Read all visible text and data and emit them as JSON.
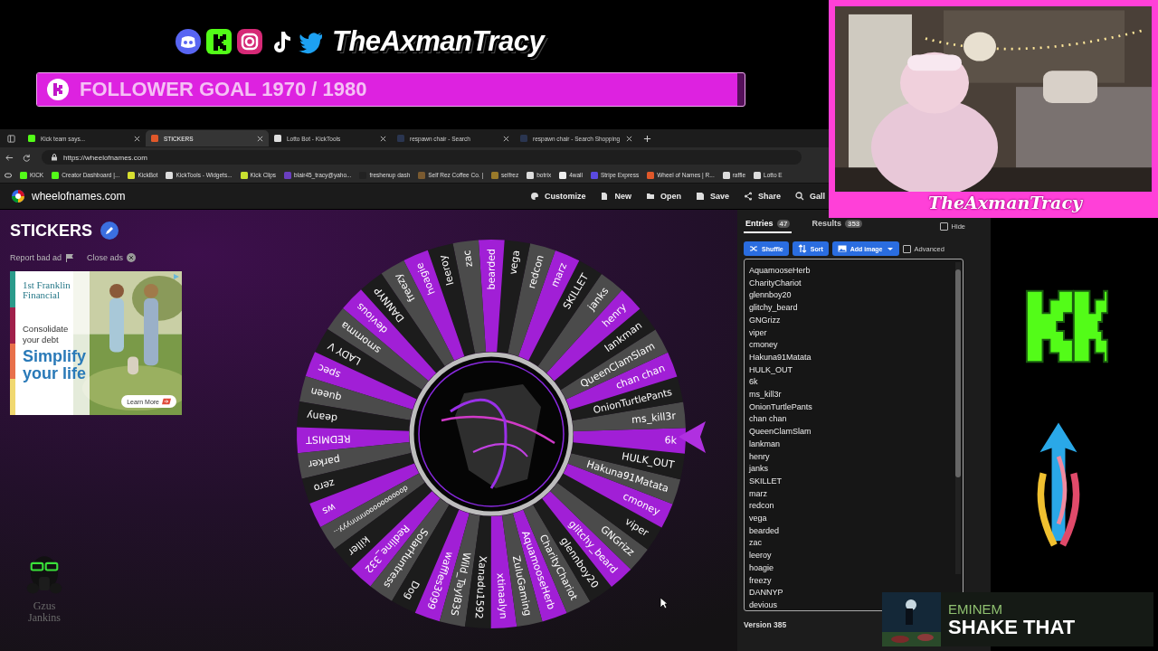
{
  "overlay": {
    "channel_name": "TheAxmanTracy",
    "goal": {
      "label": "FOLLOWER GOAL 1970 / 1980",
      "level": 0.99
    }
  },
  "browser": {
    "tabs": [
      {
        "title": "Kick team says...",
        "selected": false
      },
      {
        "title": "STICKERS",
        "selected": true
      },
      {
        "title": "Lotto Bot - KickTools",
        "selected": false
      },
      {
        "title": "respawn chair - Search",
        "selected": false
      },
      {
        "title": "respawn chair - Search Shopping",
        "selected": false
      }
    ],
    "url": "https://wheelofnames.com",
    "bookmarks": [
      "KICK",
      "Creator Dashboard |...",
      "KickBot",
      "KickTools - Widgets...",
      "Kick Clips",
      "blair45_tracy@yaho...",
      "freshenup dash",
      "Self Rez Coffee Co. |",
      "selfrez",
      "botrix",
      "4wall",
      "Stripe Express",
      "Wheel of Names | R...",
      "raffle",
      "Lotto E"
    ]
  },
  "site": {
    "name": "wheelofnames.com",
    "menu": [
      "Customize",
      "New",
      "Open",
      "Save",
      "Share",
      "Gall"
    ],
    "title": "STICKERS",
    "ad_links": [
      "Report bad ad",
      "Close ads"
    ],
    "ad": {
      "brand": "1st Franklin Financial",
      "line": "Consolidate your debt",
      "headline": "Simplify your life",
      "button": "Learn More"
    },
    "wheel": {
      "segments": [
        {
          "label": "AquamooseHerb",
          "color": "#a11fd6"
        },
        {
          "label": "CharityChariot",
          "color": "#4b4b4b"
        },
        {
          "label": "glennboy20",
          "color": "#1c1c1c"
        },
        {
          "label": "glitchy_beard",
          "color": "#a11fd6"
        },
        {
          "label": "GNGrizz",
          "color": "#4b4b4b"
        },
        {
          "label": "viper",
          "color": "#1c1c1c"
        },
        {
          "label": "cmoney",
          "color": "#a11fd6"
        },
        {
          "label": "Hakuna91Matata",
          "color": "#4b4b4b"
        },
        {
          "label": "HULK_OUT",
          "color": "#1c1c1c"
        },
        {
          "label": "6k",
          "color": "#a11fd6"
        },
        {
          "label": "ms_kill3r",
          "color": "#4b4b4b"
        },
        {
          "label": "OnionTurtlePants",
          "color": "#1c1c1c"
        },
        {
          "label": "chan chan",
          "color": "#a11fd6"
        },
        {
          "label": "QueenClamSlam",
          "color": "#4b4b4b"
        },
        {
          "label": "lankman",
          "color": "#1c1c1c"
        },
        {
          "label": "henry",
          "color": "#a11fd6"
        },
        {
          "label": "janks",
          "color": "#4b4b4b"
        },
        {
          "label": "SKILLET",
          "color": "#1c1c1c"
        },
        {
          "label": "marz",
          "color": "#a11fd6"
        },
        {
          "label": "redcon",
          "color": "#4b4b4b"
        },
        {
          "label": "vega",
          "color": "#1c1c1c"
        },
        {
          "label": "bearded",
          "color": "#a11fd6"
        },
        {
          "label": "zac",
          "color": "#4b4b4b"
        },
        {
          "label": "leeroy",
          "color": "#1c1c1c"
        },
        {
          "label": "hoagie",
          "color": "#a11fd6"
        },
        {
          "label": "freezy",
          "color": "#4b4b4b"
        },
        {
          "label": "DANNYP",
          "color": "#1c1c1c"
        },
        {
          "label": "devious",
          "color": "#a11fd6"
        },
        {
          "label": "smomma",
          "color": "#4b4b4b"
        },
        {
          "label": "LADY V",
          "color": "#1c1c1c"
        },
        {
          "label": "spec",
          "color": "#a11fd6"
        },
        {
          "label": "queen",
          "color": "#4b4b4b"
        },
        {
          "label": "deany",
          "color": "#1c1c1c"
        },
        {
          "label": "REDMIST",
          "color": "#a11fd6"
        },
        {
          "label": "parker",
          "color": "#4b4b4b"
        },
        {
          "label": "zero",
          "color": "#1c1c1c"
        },
        {
          "label": "ws",
          "color": "#a11fd6"
        },
        {
          "label": "doooooooooonnnnyyy...",
          "color": "#4b4b4b"
        },
        {
          "label": "killer",
          "color": "#1c1c1c"
        },
        {
          "label": "Redline_332",
          "color": "#a11fd6"
        },
        {
          "label": "SolarHuntress",
          "color": "#4b4b4b"
        },
        {
          "label": "Dog",
          "color": "#1c1c1c"
        },
        {
          "label": "waffles3099",
          "color": "#a11fd6"
        },
        {
          "label": "Wild_Tayl83S",
          "color": "#4b4b4b"
        },
        {
          "label": "Xanadu1592",
          "color": "#1c1c1c"
        },
        {
          "label": "xtinaalyn",
          "color": "#a11fd6"
        },
        {
          "label": "ZuluGaming",
          "color": "#4b4b4b"
        }
      ]
    },
    "panel": {
      "tabs": [
        {
          "label": "Entries",
          "count": "47",
          "selected": true
        },
        {
          "label": "Results",
          "count": "353",
          "selected": false
        }
      ],
      "hide": {
        "label": "Hide",
        "checked": false
      },
      "buttons": [
        "Shuffle",
        "Sort",
        "Add image"
      ],
      "advanced": {
        "label": "Advanced",
        "checked": false
      },
      "entries": [
        "AquamooseHerb",
        "CharityChariot",
        "glennboy20",
        "glitchy_beard",
        "GNGrizz",
        "viper",
        "cmoney",
        "Hakuna91Matata",
        "HULK_OUT",
        "6k",
        "ms_kill3r",
        "OnionTurtlePants",
        "chan chan",
        "QueenClamSlam",
        "lankman",
        "henry",
        "janks",
        "SKILLET",
        "marz",
        "redcon",
        "vega",
        "bearded",
        "zac",
        "leeroy",
        "hoagie",
        "freezy",
        "DANNYP",
        "devious"
      ],
      "version": "Version 385"
    }
  },
  "cam_name": "TheAxmanTracy",
  "logo_text": "Gzus Jankins",
  "now_playing": {
    "artist": "EMINEM",
    "title": "SHAKE THAT"
  }
}
